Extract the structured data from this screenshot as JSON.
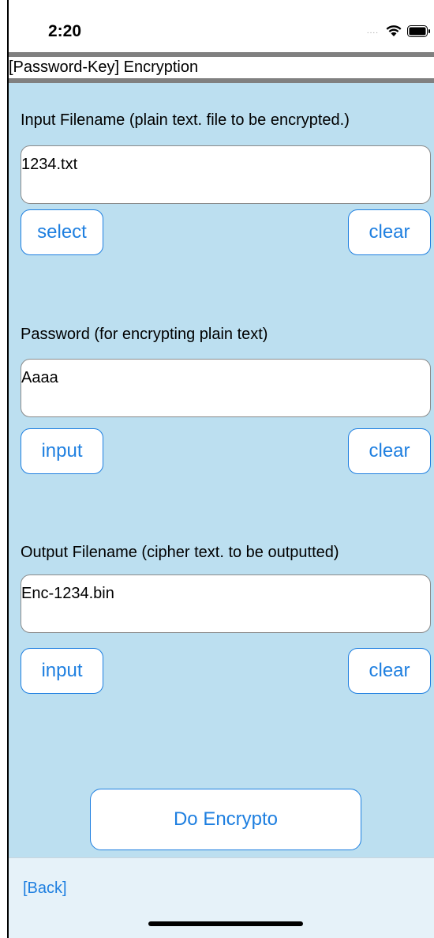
{
  "status": {
    "time": "2:20",
    "signal": "....",
    "wifi_icon": "wifi-icon",
    "battery_icon": "battery-icon"
  },
  "header": {
    "title": "[Password-Key] Encryption"
  },
  "input_file": {
    "label": "Input Filename (plain text. file to be encrypted.)",
    "value": "1234.txt",
    "left_button": "select",
    "right_button": "clear"
  },
  "password": {
    "label": "Password (for encrypting plain text)",
    "value": "Aaaa",
    "left_button": "input",
    "right_button": "clear"
  },
  "output_file": {
    "label": "Output Filename (cipher text. to be outputted)",
    "value": "Enc-1234.bin",
    "left_button": "input",
    "right_button": "clear"
  },
  "action": {
    "label": "Do Encrypto"
  },
  "footer": {
    "back_label": "[Back]"
  },
  "colors": {
    "content_background": "#bcdff0",
    "accent": "#1e7fe0",
    "footer_background": "#e6f2f9"
  }
}
